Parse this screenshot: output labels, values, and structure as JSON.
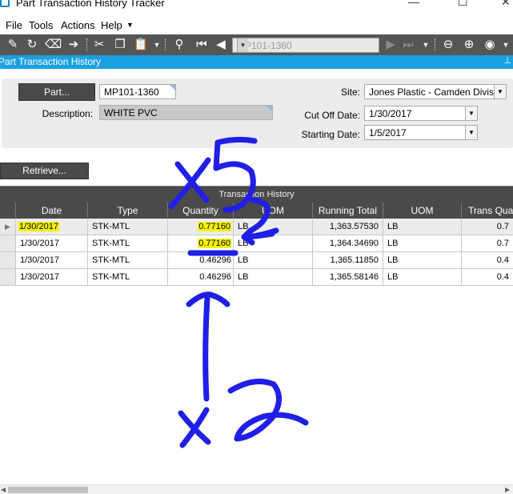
{
  "window": {
    "title": "Part Transaction History Tracker"
  },
  "menu": {
    "items": [
      "File",
      "Tools",
      "Actions",
      "Help"
    ]
  },
  "toolbar": {
    "nav_value": "MP101-1360"
  },
  "panel": {
    "title": "Part Transaction History"
  },
  "form": {
    "part_button": "Part...",
    "part_value": "MP101-1360",
    "description_label": "Description:",
    "description_value": "WHITE PVC",
    "site_label": "Site:",
    "site_value": "Jones Plastic - Camden Divisio",
    "cutoff_label": "Cut Off Date:",
    "cutoff_value": "1/30/2017",
    "starting_label": "Starting Date:",
    "starting_value": "1/5/2017",
    "retrieve_button": "Retrieve..."
  },
  "grid": {
    "caption": "Transaction History",
    "columns": [
      "Date",
      "Type",
      "Quantity",
      "UOM",
      "Running Total",
      "UOM",
      "Trans Qua"
    ],
    "rows": [
      {
        "date": "1/30/2017",
        "type": "STK-MTL",
        "quantity": "0.77160",
        "uom": "LB",
        "running_total": "1,363.57530",
        "uom2": "LB",
        "trans_qty": "0.7"
      },
      {
        "date": "1/30/2017",
        "type": "STK-MTL",
        "quantity": "0.77160",
        "uom": "LB",
        "running_total": "1,364.34690",
        "uom2": "LB",
        "trans_qty": "0.7"
      },
      {
        "date": "1/30/2017",
        "type": "STK-MTL",
        "quantity": "0.46296",
        "uom": "LB",
        "running_total": "1,365.11850",
        "uom2": "LB",
        "trans_qty": "0.4"
      },
      {
        "date": "1/30/2017",
        "type": "STK-MTL",
        "quantity": "0.46296",
        "uom": "LB",
        "running_total": "1,365.58146",
        "uom2": "LB",
        "trans_qty": "0.4"
      }
    ]
  },
  "colors": {
    "accent": "#1ba1e2",
    "toolbar": "#555555",
    "highlight": "#f4f400",
    "ink": "#1f1fe6"
  }
}
